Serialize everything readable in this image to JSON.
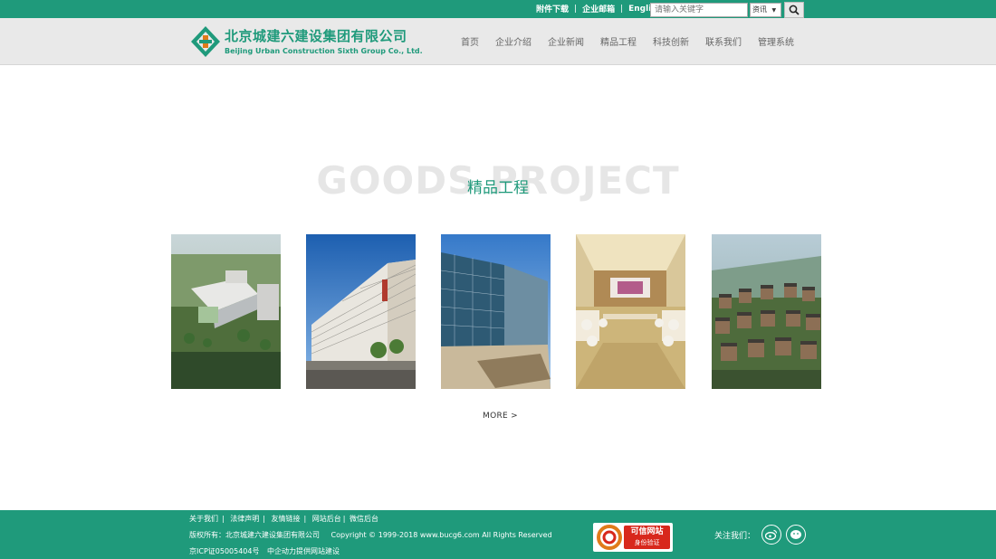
{
  "topbar": {
    "links": [
      "附件下载",
      "企业邮箱",
      "English"
    ],
    "separator": "|",
    "search_placeholder": "请输入关键字",
    "search_scope": "资讯",
    "search_scope_arrow": "▼"
  },
  "header": {
    "logo_cn": "北京城建六建设集团有限公司",
    "logo_en": "Beijing Urban Construction Sixth Group Co., Ltd.",
    "nav": [
      "首页",
      "企业介绍",
      "企业新闻",
      "精品工程",
      "科技创新",
      "联系我们",
      "管理系统"
    ]
  },
  "section": {
    "bg_title": "GOODS PROJECT",
    "title": "精品工程",
    "more": "MORE >"
  },
  "footer": {
    "links": [
      "关于我们",
      "法律声明",
      "友情链接",
      "网站后台",
      "微信后台"
    ],
    "link_seps": [
      "|",
      "|",
      "|",
      "|"
    ],
    "copyright_owner": "版权所有：北京城建六建设集团有限公司",
    "copyright": "Copyright © 1999-2018 www.bucg6.com All Rights Reserved",
    "icp": "京ICP证05005404号",
    "provider": "中企动力提供网站建设",
    "badge_title": "可信网站",
    "badge_sub": "身份验证",
    "follow_label": "关注我们："
  },
  "colors": {
    "brand_green": "#1f9a7b",
    "header_gray": "#e9e9e9",
    "badge_red": "#d8281c"
  }
}
